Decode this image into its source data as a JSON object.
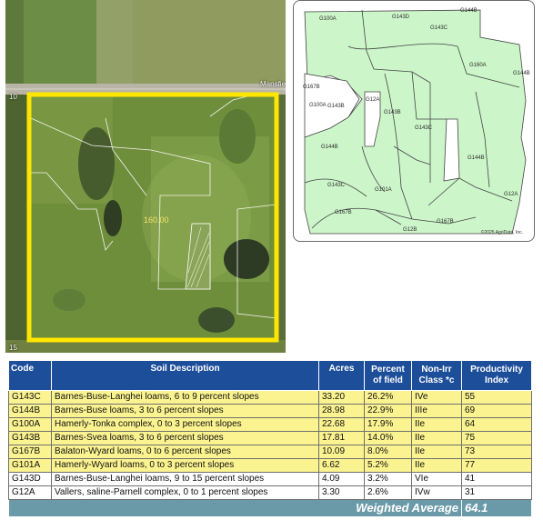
{
  "aerial": {
    "road_label": "Mansfield",
    "acres": "160.00",
    "edge_numbers": [
      "10",
      "15"
    ]
  },
  "soil_map": {
    "labels": [
      "G100A",
      "G143D",
      "G144B",
      "G143C",
      "G160A",
      "G144B",
      "G167B",
      "G100A",
      "G143B",
      "G12A",
      "G143B",
      "G143C",
      "G144B",
      "G144B",
      "G143C",
      "G101A",
      "G12A",
      "G167B",
      "G167B",
      "G12B"
    ],
    "copyright": "©2025 AgriData, Inc."
  },
  "table": {
    "headers": {
      "code": "Code",
      "description": "Soil Description",
      "acres": "Acres",
      "percent": [
        "Percent",
        "of field"
      ],
      "class": [
        "Non-Irr",
        "Class *c"
      ],
      "productivity": [
        "Productivity",
        "Index"
      ]
    },
    "rows": [
      {
        "code": "G143C",
        "description": "Barnes-Buse-Langhei loams, 6 to 9 percent slopes",
        "acres": "33.20",
        "percent": "26.2%",
        "class": "IVe",
        "productivity": "55",
        "highlight": true
      },
      {
        "code": "G144B",
        "description": "Barnes-Buse loams, 3 to 6 percent slopes",
        "acres": "28.98",
        "percent": "22.9%",
        "class": "IIIe",
        "productivity": "69",
        "highlight": true
      },
      {
        "code": "G100A",
        "description": "Hamerly-Tonka complex, 0 to 3 percent slopes",
        "acres": "22.68",
        "percent": "17.9%",
        "class": "IIe",
        "productivity": "64",
        "highlight": true
      },
      {
        "code": "G143B",
        "description": "Barnes-Svea loams, 3 to 6 percent slopes",
        "acres": "17.81",
        "percent": "14.0%",
        "class": "IIe",
        "productivity": "75",
        "highlight": true
      },
      {
        "code": "G167B",
        "description": "Balaton-Wyard loams, 0 to 6 percent slopes",
        "acres": "10.09",
        "percent": "8.0%",
        "class": "IIe",
        "productivity": "73",
        "highlight": true
      },
      {
        "code": "G101A",
        "description": "Hamerly-Wyard loams, 0 to 3 percent slopes",
        "acres": "6.62",
        "percent": "5.2%",
        "class": "IIe",
        "productivity": "77",
        "highlight": true
      },
      {
        "code": "G143D",
        "description": "Barnes-Buse-Langhei loams, 9 to 15 percent slopes",
        "acres": "4.09",
        "percent": "3.2%",
        "class": "VIe",
        "productivity": "41",
        "highlight": false
      },
      {
        "code": "G12A",
        "description": "Vallers, saline-Parnell complex, 0 to 1 percent slopes",
        "acres": "3.30",
        "percent": "2.6%",
        "class": "IVw",
        "productivity": "31",
        "highlight": false
      }
    ],
    "weighted_average": {
      "label": "Weighted Average",
      "value": "64.1"
    }
  },
  "colors": {
    "header_blue": "#1d4e9a",
    "highlight_yellow": "#fbf38f",
    "average_teal": "#6a9aa8",
    "boundary_yellow": "#ffe600",
    "soil_green": "#ccf5c9"
  }
}
